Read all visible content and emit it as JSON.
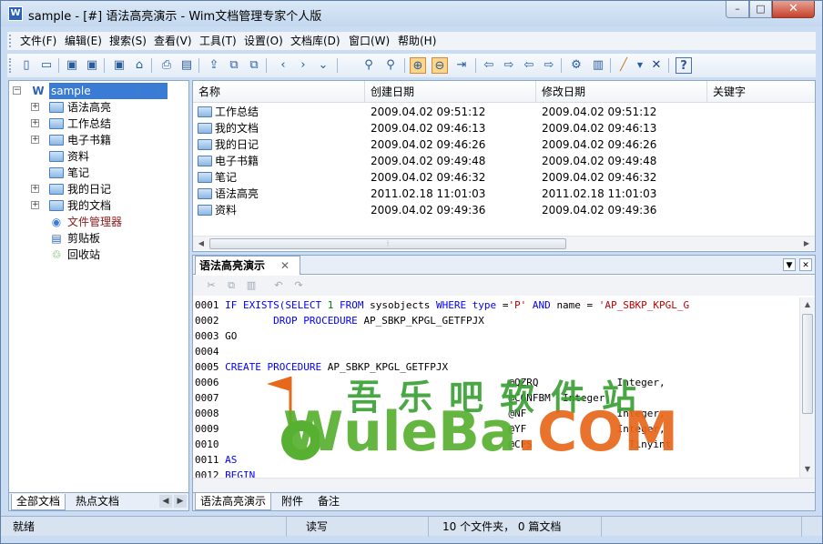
{
  "window": {
    "app_icon": "W",
    "title": "sample - [#] 语法高亮演示 - Wim文档管理专家个人版",
    "min": "–",
    "max": "□",
    "close": "✕"
  },
  "menu": [
    "文件(F)",
    "编辑(E)",
    "搜索(S)",
    "查看(V)",
    "工具(T)",
    "设置(O)",
    "文档库(D)",
    "窗口(W)",
    "帮助(H)"
  ],
  "toolbar_icons": [
    "new-doc-icon",
    "open-icon",
    "save-icon",
    "save-all-icon",
    "save-as-icon",
    "export-icon",
    "print-icon",
    "print-preview-icon",
    "import-icon",
    "copy-doc-icon",
    "paste-doc-icon",
    "back-icon",
    "forward-icon",
    "down-icon",
    "find-icon",
    "find-next-icon",
    "zoom-in-icon",
    "zoom-out-icon",
    "goto-icon",
    "prev-icon",
    "next-icon",
    "prev2-icon",
    "next2-icon",
    "properties-icon",
    "clipboard-icon",
    "pen-icon",
    "dropdown-icon",
    "delete-icon",
    "help-icon"
  ],
  "tree": {
    "root": "sample",
    "items": [
      {
        "label": "语法高亮",
        "type": "folder",
        "expand": "+"
      },
      {
        "label": "工作总结",
        "type": "folder",
        "expand": "+"
      },
      {
        "label": "电子书籍",
        "type": "folder",
        "expand": "+"
      },
      {
        "label": "资料",
        "type": "folder",
        "expand": ""
      },
      {
        "label": "笔记",
        "type": "folder",
        "expand": ""
      },
      {
        "label": "我的日记",
        "type": "folder",
        "expand": "+"
      },
      {
        "label": "我的文档",
        "type": "folder",
        "expand": "+"
      },
      {
        "label": "文件管理器",
        "type": "special",
        "expand": "",
        "color": "#8b1a1a"
      },
      {
        "label": "剪贴板",
        "type": "special",
        "expand": ""
      },
      {
        "label": "回收站",
        "type": "special",
        "expand": ""
      }
    ]
  },
  "left_tabs": [
    "全部文档",
    "热点文档"
  ],
  "list": {
    "columns": [
      "名称",
      "创建日期",
      "修改日期",
      "关键字"
    ],
    "rows": [
      {
        "name": "工作总结",
        "created": "2009.04.02 09:51:12",
        "modified": "2009.04.02 09:51:12"
      },
      {
        "name": "我的文档",
        "created": "2009.04.02 09:46:13",
        "modified": "2009.04.02 09:46:13"
      },
      {
        "name": "我的日记",
        "created": "2009.04.02 09:46:26",
        "modified": "2009.04.02 09:46:26"
      },
      {
        "name": "电子书籍",
        "created": "2009.04.02 09:49:48",
        "modified": "2009.04.02 09:49:48"
      },
      {
        "name": "笔记",
        "created": "2009.04.02 09:46:32",
        "modified": "2009.04.02 09:46:32"
      },
      {
        "name": "语法高亮",
        "created": "2011.02.18 11:01:03",
        "modified": "2011.02.18 11:01:03"
      },
      {
        "name": "资料",
        "created": "2009.04.02 09:49:36",
        "modified": "2009.04.02 09:49:36"
      }
    ]
  },
  "doc_tab": {
    "title": "语法高亮演示",
    "close": "✕"
  },
  "code_lines": [
    [
      {
        "t": "0001 ",
        "c": "ln"
      },
      {
        "t": "IF EXISTS(SELECT ",
        "c": "kw"
      },
      {
        "t": "1",
        "c": "nu"
      },
      {
        "t": " FROM ",
        "c": "kw"
      },
      {
        "t": "sysobjects ",
        "c": "tx"
      },
      {
        "t": "WHERE type ",
        "c": "kw"
      },
      {
        "t": "=",
        "c": "tx"
      },
      {
        "t": "'P'",
        "c": "st"
      },
      {
        "t": " AND ",
        "c": "kw"
      },
      {
        "t": "name = ",
        "c": "tx"
      },
      {
        "t": "'AP_SBKP_KPGL_G",
        "c": "st"
      }
    ],
    [
      {
        "t": "0002         ",
        "c": "ln"
      },
      {
        "t": "DROP PROCEDURE ",
        "c": "kw"
      },
      {
        "t": "AP_SBKP_KPGL_GETFPJX",
        "c": "tx"
      }
    ],
    [
      {
        "t": "0003 ",
        "c": "ln"
      },
      {
        "t": "GO",
        "c": "tx"
      }
    ],
    [
      {
        "t": "0004",
        "c": "ln"
      }
    ],
    [
      {
        "t": "0005 ",
        "c": "ln"
      },
      {
        "t": "CREATE PROCEDURE ",
        "c": "kw"
      },
      {
        "t": "AP_SBKP_KPGL_GETFPJX",
        "c": "tx"
      }
    ],
    [
      {
        "t": "0006                                                ",
        "c": "ln"
      },
      {
        "t": "@QZRQ             ",
        "c": "tx"
      },
      {
        "t": "Integer,",
        "c": "tx"
      }
    ],
    [
      {
        "t": "0007                                                ",
        "c": "ln"
      },
      {
        "t": "@CONFBM  ",
        "c": "tx"
      },
      {
        "t": "Integer,",
        "c": "tx"
      }
    ],
    [
      {
        "t": "0008                                                ",
        "c": "ln"
      },
      {
        "t": "@NF               ",
        "c": "tx"
      },
      {
        "t": "Integer,",
        "c": "tx"
      }
    ],
    [
      {
        "t": "0009                                                ",
        "c": "ln"
      },
      {
        "t": "@YF               ",
        "c": "tx"
      },
      {
        "t": "Integer,",
        "c": "tx"
      }
    ],
    [
      {
        "t": "0010                                                ",
        "c": "ln"
      },
      {
        "t": "@CFS                ",
        "c": "tx"
      },
      {
        "t": "Tinyint",
        "c": "tx"
      }
    ],
    [
      {
        "t": "0011 ",
        "c": "ln"
      },
      {
        "t": "AS",
        "c": "kw"
      }
    ],
    [
      {
        "t": "0012 ",
        "c": "ln"
      },
      {
        "t": "BEGIN",
        "c": "kw"
      }
    ]
  ],
  "bottom_tabs": [
    "语法高亮演示",
    "附件",
    "备注"
  ],
  "status": {
    "ready": "就绪",
    "mode": "读写",
    "count": "10 个文件夹， 0 篇文档"
  },
  "watermark": {
    "cn": "吾乐吧软件站",
    "en_a": "WuleBa",
    "en_b": ".COM"
  },
  "colors": {
    "keyword": "#0000ff",
    "string": "#c00000",
    "number": "#008000",
    "selection": "#3a7bd5"
  }
}
